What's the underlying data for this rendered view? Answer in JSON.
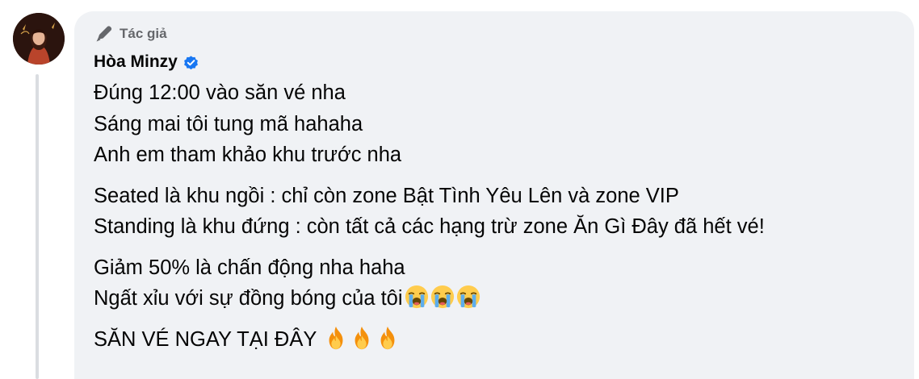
{
  "comment": {
    "badge_label": "Tác giả",
    "author_name": "Hòa Minzy",
    "paragraphs": [
      [
        "Đúng 12:00 vào săn vé nha",
        "Sáng mai tôi tung mã hahaha",
        "Anh em tham khảo khu trước nha"
      ],
      [
        "Seated là khu ngồi : chỉ còn zone Bật Tình Yêu Lên và zone VIP",
        "Standing là khu đứng : còn tất cả các hạng trừ zone Ăn Gì Đây đã hết vé!"
      ],
      [
        "Giảm 50% là chấn động nha haha",
        "Ngất xỉu với sự đồng bóng của tôi"
      ],
      [
        "SĂN VÉ NGAY TẠI ĐÂY"
      ]
    ],
    "emojis": {
      "crying": [
        "loudly-crying-face-icon",
        "loudly-crying-face-icon",
        "loudly-crying-face-icon"
      ],
      "fire": [
        "fire-icon",
        "fire-icon",
        "fire-icon"
      ]
    }
  },
  "colors": {
    "bubble_background": "#f0f2f5",
    "text": "#050505",
    "secondary_text": "#65676b",
    "verified_blue": "#1877f2"
  }
}
